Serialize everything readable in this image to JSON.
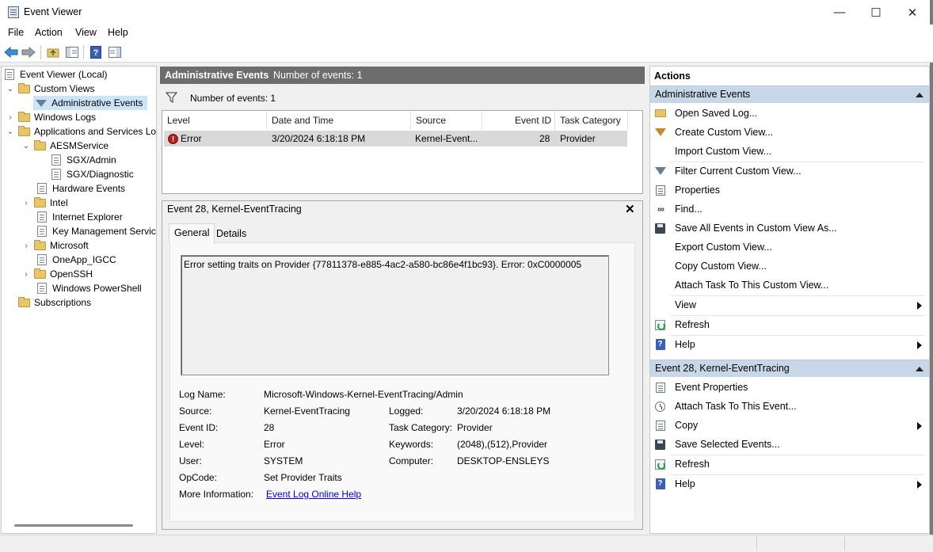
{
  "window": {
    "title": "Event Viewer",
    "minimize": "—",
    "maximize": "☐",
    "close": "✕"
  },
  "menu": [
    "File",
    "Action",
    "View",
    "Help"
  ],
  "tree": {
    "root": "Event Viewer (Local)",
    "custom_views": "Custom Views",
    "administrative_events": "Administrative Events",
    "windows_logs": "Windows Logs",
    "apps_services": "Applications and Services Lo",
    "aesm": "AESMService",
    "sgx_admin": "SGX/Admin",
    "sgx_diag": "SGX/Diagnostic",
    "hardware": "Hardware Events",
    "intel": "Intel",
    "ie": "Internet Explorer",
    "kms": "Key Management Service",
    "microsoft": "Microsoft",
    "oneapp": "OneApp_IGCC",
    "openssh": "OpenSSH",
    "powershell": "Windows PowerShell",
    "subscriptions": "Subscriptions"
  },
  "center": {
    "header_title": "Administrative Events",
    "header_count": "Number of events: 1",
    "filter_count": "Number of events: 1",
    "columns": {
      "level": "Level",
      "datetime": "Date and Time",
      "source": "Source",
      "event_id": "Event ID",
      "task_category": "Task Category"
    },
    "row": {
      "level": "Error",
      "datetime": "3/20/2024 6:18:18 PM",
      "source": "Kernel-Event...",
      "event_id": "28",
      "task_category": "Provider"
    }
  },
  "detail": {
    "title": "Event 28, Kernel-EventTracing",
    "close": "✕",
    "tabs": {
      "general": "General",
      "details": "Details"
    },
    "description": "Error setting traits on Provider {77811378-e885-4ac2-a580-bc86e4f1bc93}. Error: 0xC0000005",
    "labels": {
      "log_name": "Log Name:",
      "source": "Source:",
      "event_id": "Event ID:",
      "level": "Level:",
      "user": "User:",
      "opcode": "OpCode:",
      "more_info": "More Information:",
      "logged": "Logged:",
      "task_category": "Task Category:",
      "keywords": "Keywords:",
      "computer": "Computer:"
    },
    "values": {
      "log_name": "Microsoft-Windows-Kernel-EventTracing/Admin",
      "source": "Kernel-EventTracing",
      "event_id": "28",
      "level": "Error",
      "user": "SYSTEM",
      "opcode": "Set Provider Traits",
      "more_info": "Event Log Online Help",
      "logged": "3/20/2024 6:18:18 PM",
      "task_category": "Provider",
      "keywords": "(2048),(512),Provider",
      "computer": "DESKTOP-ENSLEYS"
    }
  },
  "actions": {
    "title": "Actions",
    "section1": "Administrative Events",
    "items1": [
      "Open Saved Log...",
      "Create Custom View...",
      "Import Custom View...",
      "Filter Current Custom View...",
      "Properties",
      "Find...",
      "Save All Events in Custom View As...",
      "Export Custom View...",
      "Copy Custom View...",
      "Attach Task To This Custom View...",
      "View",
      "Refresh",
      "Help"
    ],
    "section2": "Event 28, Kernel-EventTracing",
    "items2": [
      "Event Properties",
      "Attach Task To This Event...",
      "Copy",
      "Save Selected Events...",
      "Refresh",
      "Help"
    ]
  }
}
